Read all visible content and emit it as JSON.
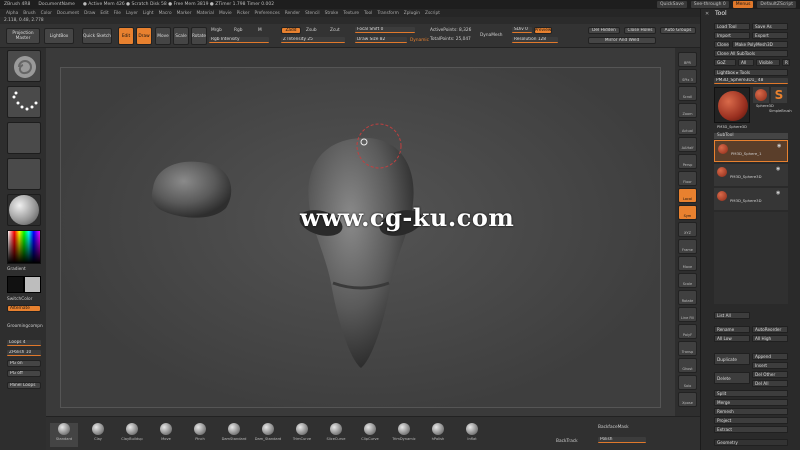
{
  "titlebar": {
    "app": "ZBrush 4R8",
    "document": "DocumentName",
    "stats": "● Active Mem 426 ● Scratch Disk 58 ● Free Mem 3819 ● ZTimer 1.798 Timer 0.002",
    "quicksave": "QuickSave",
    "seethrough": "See-through 0",
    "menus": "Menus",
    "defaultscript": "DefaultZScript"
  },
  "menubar": [
    "Alpha",
    "Brush",
    "Color",
    "Document",
    "Draw",
    "Edit",
    "File",
    "Layer",
    "Light",
    "Macro",
    "Marker",
    "Material",
    "Movie",
    "Picker",
    "Preferences",
    "Render",
    "Stencil",
    "Stroke",
    "Texture",
    "Tool",
    "Transform",
    "Zplugin",
    "Zscript"
  ],
  "coords": "2.118, 0.48, 2.778",
  "topshelf": {
    "projection_master": "Projection Master",
    "lightbox": "LightBox",
    "quick_sketch": "Quick Sketch",
    "edit": "Edit",
    "draw": "Draw",
    "move": "Move",
    "scale": "Scale",
    "rotate": "Rotate",
    "mrgb": "Mrgb",
    "rgb": "Rgb",
    "m": "M",
    "rgb_intensity": "Rgb Intensity",
    "zadd": "Zadd",
    "zsub": "Zsub",
    "zcut": "Zcut",
    "z_intensity": "Z Intensity 25",
    "focal_shift": "Focal Shift 0",
    "draw_size": "Draw Size 82",
    "dynamic": "Dynamic",
    "active_points": "ActivePoints: 8,326",
    "total_points": "TotalPoints: 25,047",
    "dynamesh": "DynaMesh",
    "sdiv": "SDiv 0",
    "preview": "Preview",
    "resolution": "Resolution 128",
    "del_hidden": "Del Hidden",
    "close_holes": "Close Holes",
    "auto_groups": "Auto Groups",
    "mirror_and_weld": "Mirror And Weld"
  },
  "leftshelf": {
    "gradient": "Gradient",
    "switchcolor": "SwitchColor",
    "alternate": "Alternate",
    "grooming": "Groomingcompn",
    "loops": "Loops 4",
    "zpolish": "ZPolish 10",
    "pg_on": "PG on",
    "pg_off": "PG off",
    "panel_loops": "Panel Loops"
  },
  "rightshelf": [
    "BPR",
    "SPix 3",
    "Scroll",
    "Zoom",
    "Actual",
    "AAHalf",
    "Persp",
    "Floor",
    "Local",
    "Sym",
    "XYZ",
    "Frame",
    "Move",
    "Scale",
    "Rotate",
    "Line Fill",
    "PolyF",
    "Transp",
    "Ghost",
    "Solo",
    "Xpose"
  ],
  "tray": {
    "title": "Tool",
    "load_tool": "Load Tool",
    "save_as": "Save As",
    "import": "Import",
    "export": "Export",
    "clone": "Clone",
    "make_polymesh": "Make PolyMesh3D",
    "clone_all": "Clone All SubTools",
    "goz": "GoZ",
    "all": "All",
    "visible": "Visible",
    "r": "R",
    "lightbox_tools": "Lightbox ▸ Tools",
    "current_tool": "PM3D_Sphere3D1_ 48",
    "tool_names": [
      "Sphere3D",
      "SimpleBrush",
      "PM3D_Sphere3D"
    ],
    "subtool": "SubTool",
    "subtools": [
      "PM3D_Sphere_1",
      "PM3D_Sphere3D",
      "PM3D_Sphere3D"
    ],
    "list_all": "List All",
    "rename": "Rename",
    "autoreorder": "AutoReorder",
    "all_low": "All Low",
    "all_high": "All High",
    "duplicate": "Duplicate",
    "append": "Append",
    "insert": "Insert",
    "delete": "Delete",
    "del_other": "Del Other",
    "del_all": "Del All",
    "split": "Split",
    "merge": "Merge",
    "remesh": "Remesh",
    "project": "Project",
    "extract": "Extract",
    "geometry": "Geometry"
  },
  "brushes": [
    "Standard",
    "Clay",
    "ClayBuildup",
    "Move",
    "Pinch",
    "DamStandard",
    "Dam_Standard",
    "TrimCurve",
    "SliceCurve",
    "ClipCurve",
    "TrimDynamic",
    "hPolish",
    "Inflat"
  ],
  "bottom": {
    "backface_mask": "BackfaceMask",
    "polish": "Polish",
    "backtrack": "BackTrack"
  },
  "watermark": "www.cg-ku.com",
  "colors": {
    "accent": "#e8812f",
    "panel": "#333333",
    "canvas": "#4a4a4a"
  }
}
